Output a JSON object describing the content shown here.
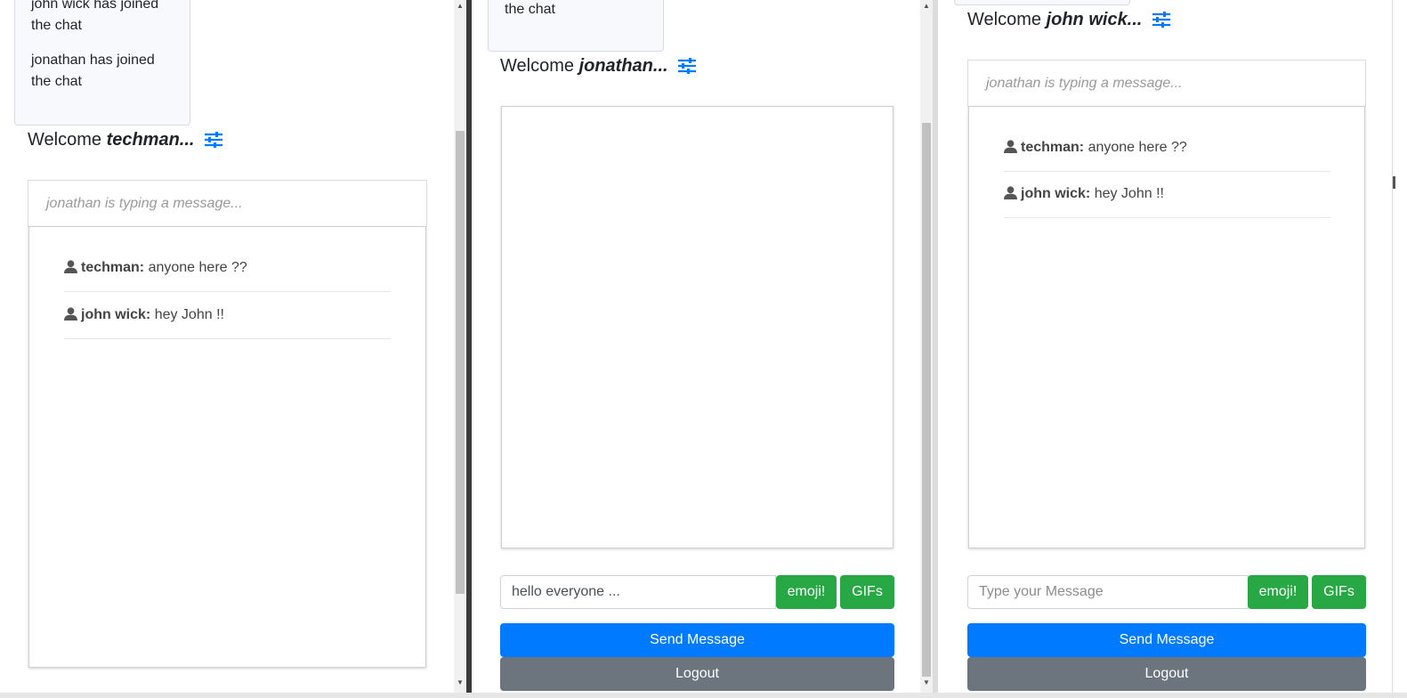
{
  "colors": {
    "primary": "#007bff",
    "success": "#28a745",
    "secondary": "#6c757d"
  },
  "icons": {
    "settings": "sliders-icon",
    "user": "user-icon"
  },
  "windows": [
    {
      "notifications": [
        "john wick has joined the chat",
        "jonathan has joined the chat"
      ],
      "welcome_prefix": "Welcome",
      "username": "techman...",
      "typing_status": "jonathan is typing a message...",
      "messages": [
        {
          "user": "techman:",
          "text": "anyone here ??"
        },
        {
          "user": "john wick:",
          "text": "hey John !!"
        }
      ]
    },
    {
      "notifications": [
        "the chat"
      ],
      "welcome_prefix": "Welcome",
      "username": "jonathan...",
      "messages": [],
      "input_value": "hello everyone ...",
      "emoji_label": "emoji!",
      "gifs_label": "GIFs",
      "send_label": "Send Message",
      "logout_label": "Logout"
    },
    {
      "welcome_prefix": "Welcome",
      "username": "john wick...",
      "typing_status": "jonathan is typing a message...",
      "messages": [
        {
          "user": "techman:",
          "text": "anyone here ??"
        },
        {
          "user": "john wick:",
          "text": "hey John !!"
        }
      ],
      "input_placeholder": "Type your Message",
      "emoji_label": "emoji!",
      "gifs_label": "GIFs",
      "send_label": "Send Message",
      "logout_label": "Logout"
    }
  ]
}
